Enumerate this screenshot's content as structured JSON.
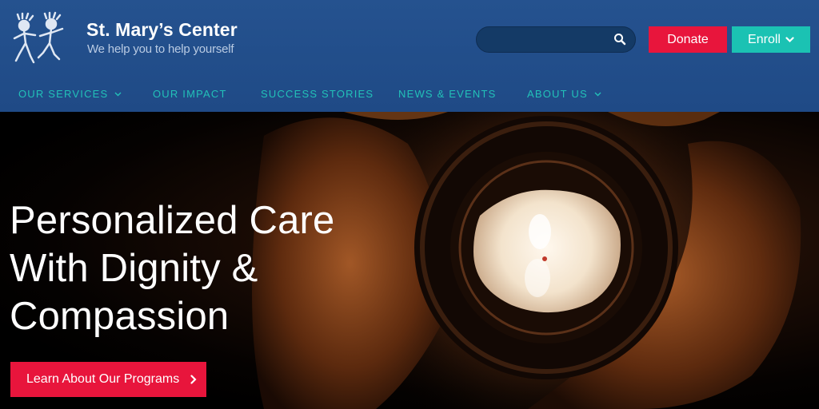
{
  "brand": {
    "name": "St. Mary’s Center",
    "tagline": "We help you to help yourself",
    "logo_icon": "dancing-figures-logo"
  },
  "header": {
    "search": {
      "placeholder": "",
      "value": "",
      "icon": "search-icon"
    },
    "donate_label": "Donate",
    "enroll_label": "Enroll"
  },
  "nav": {
    "items": [
      {
        "label": "OUR SERVICES",
        "has_dropdown": true
      },
      {
        "label": "OUR IMPACT",
        "has_dropdown": false
      },
      {
        "label": "SUCCESS STORIES",
        "has_dropdown": false
      },
      {
        "label": "NEWS & EVENTS",
        "has_dropdown": false
      },
      {
        "label": "ABOUT US",
        "has_dropdown": true
      }
    ]
  },
  "hero": {
    "title_lines": [
      "Personalized Care",
      "With Dignity &",
      "Compassion"
    ],
    "cta_label": "Learn About Our Programs",
    "image": "hands-holding-candle"
  },
  "colors": {
    "header_bg": "#25528f",
    "accent_red": "#e8153c",
    "accent_teal": "#1bc2b3",
    "nav_text": "#22c1b8"
  }
}
